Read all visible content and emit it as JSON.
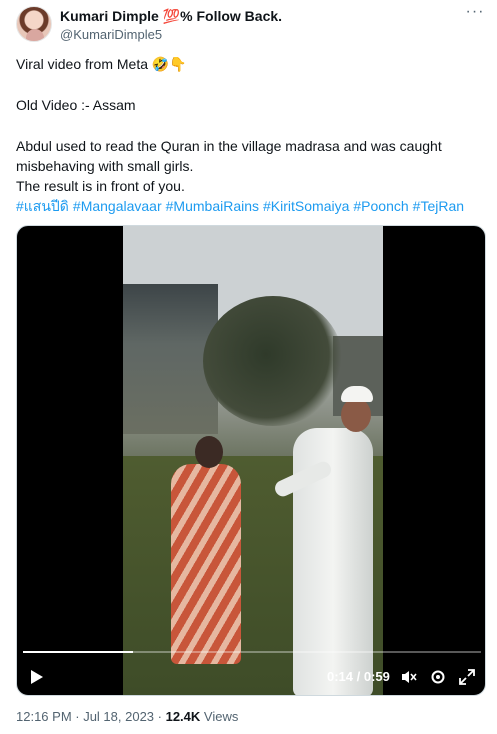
{
  "author": {
    "display_name": "Kumari Dimple 💯% Follow Back.",
    "handle": "@KumariDimple5"
  },
  "more_icon": "more-horizontal-icon",
  "body": {
    "line1": "Viral video from Meta 🤣👇",
    "line2": "Old Video :- Assam",
    "line3": "Abdul used to read the Quran in the village madrasa and was caught",
    "line4": "misbehaving with small girls.",
    "line5": "The result is in front of you.",
    "hashtags": [
      "#แสนปีดิ",
      "#Mangalavaar",
      "#MumbaiRains",
      "#KiritSomaiya",
      "#Poonch",
      "#TejRan"
    ]
  },
  "video": {
    "current_time": "0:14",
    "duration": "0:59",
    "time_display": "0:14 / 0:59",
    "progress": 0.24,
    "icons": [
      "play-icon",
      "mute-icon",
      "settings-icon",
      "fullscreen-icon"
    ]
  },
  "meta": {
    "timestamp": "12:16 PM · Jul 18, 2023 · ",
    "views_count": "12.4K",
    "views_label": " Views"
  },
  "colors": {
    "link": "#1d9bf0",
    "secondary_text": "#536471",
    "primary_text": "#0f1419"
  }
}
